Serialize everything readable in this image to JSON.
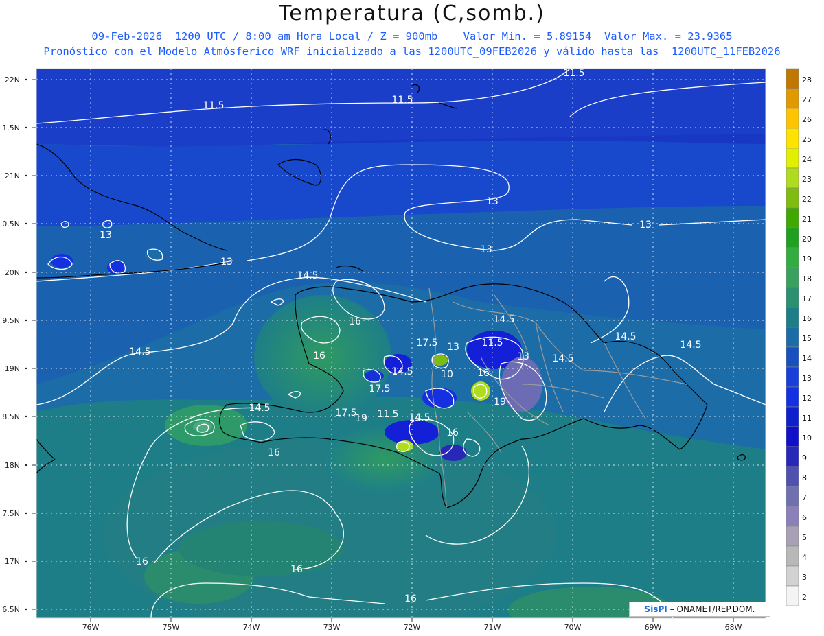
{
  "header": {
    "title": "Temperatura (C,somb.)",
    "line1": "09-Feb-2026  1200 UTC / 8:00 am Hora Local / Z = 900mb    Valor Min. = 5.89154  Valor Max. = 23.9365",
    "line2": "Pronóstico con el Modelo Atmósferico WRF inicializado a las 1200UTC_09FEB2026 y válido hasta las  1200UTC_11FEB2026"
  },
  "axes": {
    "lat_ticks": [
      "22N",
      "1.5N",
      "21N",
      "0.5N",
      "20N",
      "9.5N",
      "19N",
      "8.5N",
      "18N",
      "7.5N",
      "17N",
      "6.5N"
    ],
    "lon_ticks": [
      "76W",
      "75W",
      "74W",
      "73W",
      "72W",
      "71W",
      "70W",
      "69W",
      "68W"
    ]
  },
  "colorbar": {
    "levels": [
      "28",
      "27",
      "26",
      "25",
      "24",
      "23",
      "22",
      "21",
      "20",
      "19",
      "18",
      "17",
      "16",
      "15",
      "14",
      "13",
      "12",
      "11",
      "10",
      "9",
      "8",
      "7",
      "6",
      "5",
      "4",
      "3",
      "2"
    ],
    "colors": [
      "#c07800",
      "#e09a00",
      "#ffc400",
      "#ffe200",
      "#e0f000",
      "#b0dc20",
      "#80bc10",
      "#40a800",
      "#20a020",
      "#32ac40",
      "#3aa060",
      "#2a9070",
      "#1e7e88",
      "#1c6ca8",
      "#1850c0",
      "#1840d8",
      "#1430e0",
      "#0e20cc",
      "#1010c8",
      "#2828b8",
      "#5050b0",
      "#7070b0",
      "#8c80b8",
      "#a8a0b4",
      "#b8b8b8",
      "#d2d2d2",
      "#f4f4f4"
    ]
  },
  "contour_labels": [
    {
      "text": "11.5"
    },
    {
      "text": "11.5"
    },
    {
      "text": "11.5"
    },
    {
      "text": "13"
    },
    {
      "text": "13"
    },
    {
      "text": "13"
    },
    {
      "text": "13"
    },
    {
      "text": "13"
    },
    {
      "text": "14.5"
    },
    {
      "text": "14.5"
    },
    {
      "text": "14.5"
    },
    {
      "text": "14.5"
    },
    {
      "text": "14.5"
    },
    {
      "text": "14.5"
    },
    {
      "text": "14.5"
    },
    {
      "text": "14.5"
    },
    {
      "text": "14.5"
    },
    {
      "text": "16"
    },
    {
      "text": "16"
    },
    {
      "text": "16"
    },
    {
      "text": "16"
    },
    {
      "text": "16"
    },
    {
      "text": "16"
    },
    {
      "text": "16"
    },
    {
      "text": "16"
    },
    {
      "text": "17.5"
    },
    {
      "text": "17.5"
    },
    {
      "text": "17.5"
    },
    {
      "text": "19"
    },
    {
      "text": "19"
    },
    {
      "text": "10"
    },
    {
      "text": "11.5"
    },
    {
      "text": "13"
    },
    {
      "text": "13"
    },
    {
      "text": "11.5"
    }
  ],
  "credit": {
    "brand": "SisPI",
    "text": "– ONAMET/REP.DOM."
  }
}
